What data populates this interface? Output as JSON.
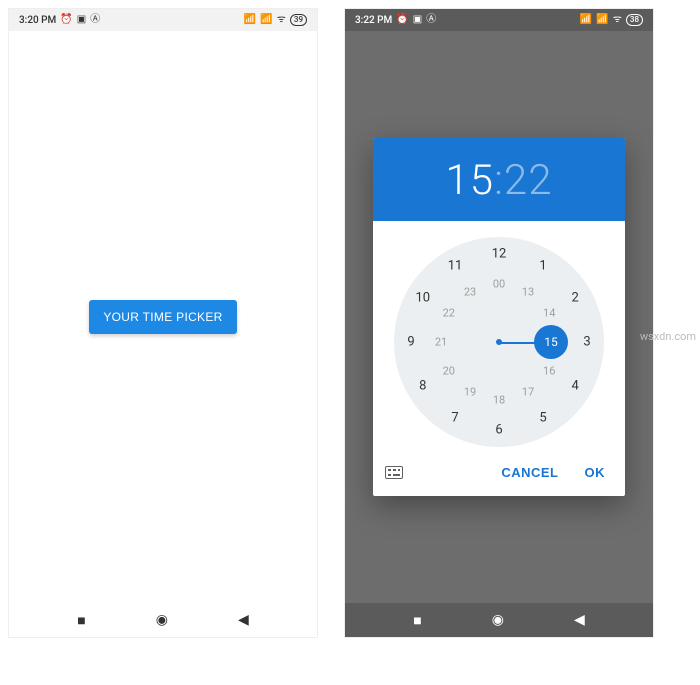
{
  "left": {
    "status": {
      "time": "3:20 PM",
      "battery": "39"
    },
    "button_label": "YOUR TIME PICKER"
  },
  "right": {
    "status": {
      "time": "3:22 PM",
      "battery": "38"
    },
    "picker": {
      "hour": "15",
      "minute": "22",
      "cancel": "CANCEL",
      "ok": "OK",
      "selected_hour": "15",
      "outer_hours": [
        "12",
        "1",
        "2",
        "3",
        "4",
        "5",
        "6",
        "7",
        "8",
        "9",
        "10",
        "11"
      ],
      "inner_hours": [
        "00",
        "13",
        "14",
        "15",
        "16",
        "17",
        "18",
        "19",
        "20",
        "21",
        "22",
        "23"
      ]
    }
  },
  "watermark": "wsxdn.com",
  "colors": {
    "accent": "#1976d2",
    "button": "#1e88e5"
  }
}
